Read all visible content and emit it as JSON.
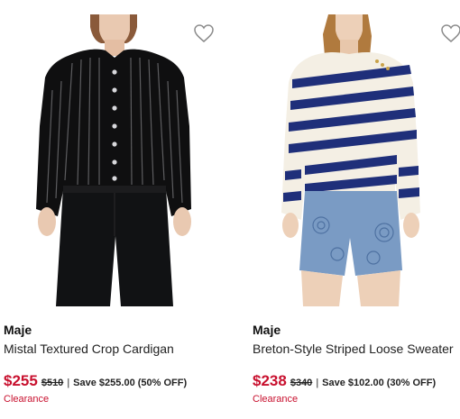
{
  "products": [
    {
      "brand": "Maje",
      "title": "Mistal Textured Crop Cardigan",
      "sale_price": "$255",
      "original_price": "$510",
      "separator": "|",
      "save_text": "Save $255.00 (50% OFF)",
      "badge": "Clearance",
      "image_icon": "woman-black-sequin-cardigan-photo",
      "wishlist_icon": "heart-outline-icon"
    },
    {
      "brand": "Maje",
      "title": "Breton-Style Striped Loose Sweater",
      "sale_price": "$238",
      "original_price": "$340",
      "separator": "|",
      "save_text": "Save $102.00 (30% OFF)",
      "badge": "Clearance",
      "image_icon": "woman-striped-sweater-denim-shorts-photo",
      "wishlist_icon": "heart-outline-icon"
    }
  ],
  "colors": {
    "sale_red": "#c8102e",
    "text_dark": "#1a1a1a",
    "stripe_navy": "#1f2f7a",
    "cream": "#f4efe4",
    "denim": "#7a9bc4"
  }
}
